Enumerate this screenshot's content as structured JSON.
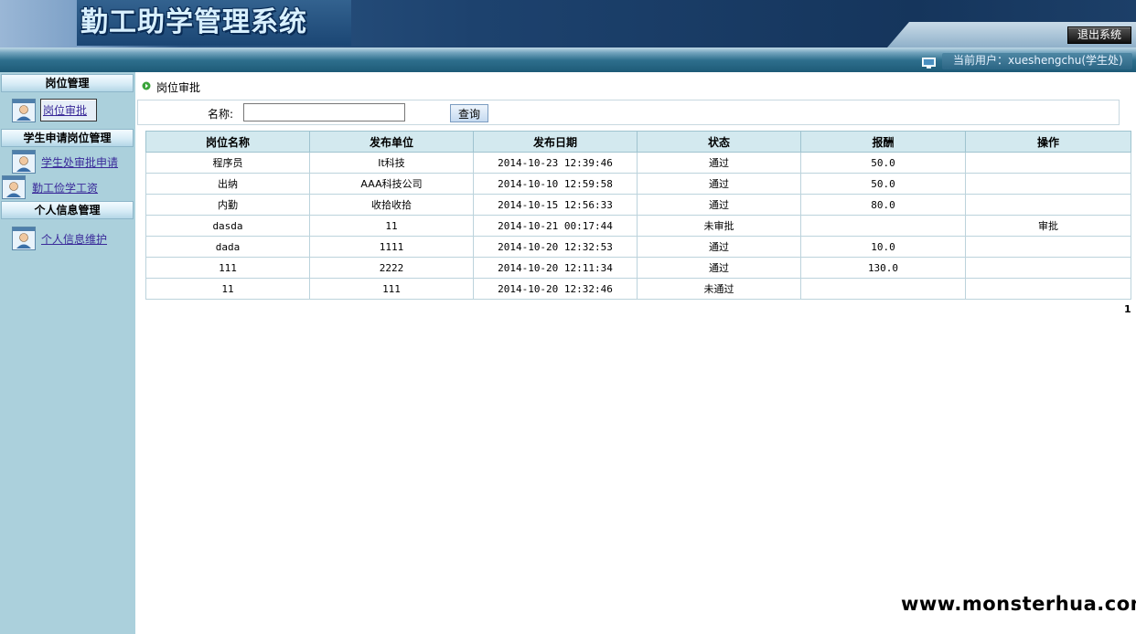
{
  "header": {
    "app_title": "勤工助学管理系统",
    "logout_label": "退出系统",
    "current_user": "当前用户：xueshengchu(学生处)"
  },
  "sidebar": {
    "sections": [
      {
        "title": "岗位管理",
        "items": [
          {
            "label": "岗位审批",
            "active": true
          }
        ]
      },
      {
        "title": "学生申请岗位管理",
        "items": [
          {
            "label": "学生处审批申请"
          },
          {
            "label": "勤工俭学工资"
          }
        ]
      },
      {
        "title": "个人信息管理",
        "items": [
          {
            "label": "个人信息维护"
          }
        ]
      }
    ]
  },
  "main": {
    "breadcrumb": "岗位审批",
    "search": {
      "label": "名称:",
      "value": "",
      "placeholder": "",
      "button_label": "查询"
    },
    "table": {
      "headers": [
        "岗位名称",
        "发布单位",
        "发布日期",
        "状态",
        "报酬",
        "操作"
      ],
      "rows": [
        [
          "程序员",
          "It科技",
          "2014-10-23 12:39:46",
          "通过",
          "50.0",
          ""
        ],
        [
          "出纳",
          "AAA科技公司",
          "2014-10-10 12:59:58",
          "通过",
          "50.0",
          ""
        ],
        [
          "内勤",
          "收拾收拾",
          "2014-10-15 12:56:33",
          "通过",
          "80.0",
          ""
        ],
        [
          "dasda",
          "11",
          "2014-10-21 00:17:44",
          "未审批",
          "",
          "审批"
        ],
        [
          "dada",
          "1111",
          "2014-10-20 12:32:53",
          "通过",
          "10.0",
          ""
        ],
        [
          "111",
          "2222",
          "2014-10-20 12:11:34",
          "通过",
          "130.0",
          ""
        ],
        [
          "11",
          "111",
          "2014-10-20 12:32:46",
          "未通过",
          "",
          ""
        ]
      ]
    },
    "pager": {
      "current_page": "1"
    }
  },
  "watermark": "www.monsterhua.com",
  "icons": {
    "nav_item": "user-card-icon",
    "breadcrumb": "green-arrow-icon",
    "user_box": "monitor-icon"
  },
  "colors": {
    "header_dark": "#1d426e",
    "sidebar_bg": "#abd0dc",
    "table_header_bg": "#d3e9ef",
    "link": "#3a2a99",
    "crumb_arrow": "#3aa43a"
  }
}
